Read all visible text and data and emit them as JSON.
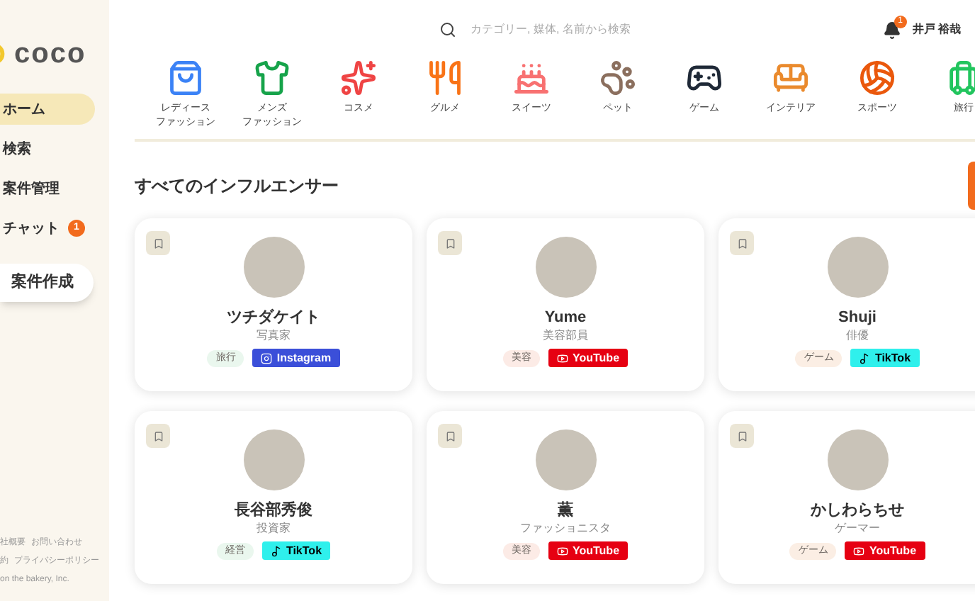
{
  "sidebar": {
    "logo": "coco",
    "items": [
      {
        "label": "ホーム",
        "selected": true
      },
      {
        "label": "検索",
        "selected": false
      },
      {
        "label": "案件管理",
        "selected": false
      },
      {
        "label": "チャット",
        "selected": false,
        "badge": "1"
      }
    ],
    "create_button": "案件作成",
    "footer_links": [
      "社概要",
      "お問い合わせ",
      "約",
      "プライバシーポリシー"
    ],
    "copyright": "on the bakery, Inc."
  },
  "header": {
    "search": {
      "placeholder": "カテゴリー, 媒体, 名前から検索"
    },
    "notification_count": "1",
    "user_name": "井戸 裕哉"
  },
  "categories": [
    {
      "kind": "ladies",
      "label": [
        "レディース",
        "ファッション"
      ]
    },
    {
      "kind": "mens",
      "label": [
        "メンズ",
        "ファッション"
      ]
    },
    {
      "kind": "cosme",
      "label": [
        "コスメ"
      ]
    },
    {
      "kind": "gourmet",
      "label": [
        "グルメ"
      ]
    },
    {
      "kind": "sweets",
      "label": [
        "スイーツ"
      ]
    },
    {
      "kind": "pet",
      "label": [
        "ペット"
      ]
    },
    {
      "kind": "game",
      "label": [
        "ゲーム"
      ]
    },
    {
      "kind": "interior",
      "label": [
        "インテリア"
      ]
    },
    {
      "kind": "sports",
      "label": [
        "スポーツ"
      ]
    },
    {
      "kind": "travel",
      "label": [
        "旅行"
      ]
    }
  ],
  "section_title": "すべてのインフルエンサー",
  "influencers": [
    {
      "name": "ツチダケイト",
      "role": "写真家",
      "tag": {
        "label": "旅行",
        "color": "#eaf7ee"
      },
      "platform": {
        "kind": "instagram",
        "label": "Instagram"
      }
    },
    {
      "name": "Yume",
      "role": "美容部員",
      "tag": {
        "label": "美容",
        "color": "#fcebe6"
      },
      "platform": {
        "kind": "youtube",
        "label": "YouTube"
      }
    },
    {
      "name": "Shuji",
      "role": "俳優",
      "tag": {
        "label": "ゲーム",
        "color": "#fbeee4"
      },
      "platform": {
        "kind": "tiktok",
        "label": "TikTok"
      }
    },
    {
      "name": "長谷部秀俊",
      "role": "投資家",
      "tag": {
        "label": "経営",
        "color": "#eaf7ee"
      },
      "platform": {
        "kind": "tiktok",
        "label": "TikTok"
      }
    },
    {
      "name": "薫",
      "role": "ファッショニスタ",
      "tag": {
        "label": "美容",
        "color": "#fcebe6"
      },
      "platform": {
        "kind": "youtube",
        "label": "YouTube"
      }
    },
    {
      "name": "かしわらちせ",
      "role": "ゲーマー",
      "tag": {
        "label": "ゲーム",
        "color": "#fbeee4"
      },
      "platform": {
        "kind": "youtube",
        "label": "YouTube"
      }
    }
  ]
}
